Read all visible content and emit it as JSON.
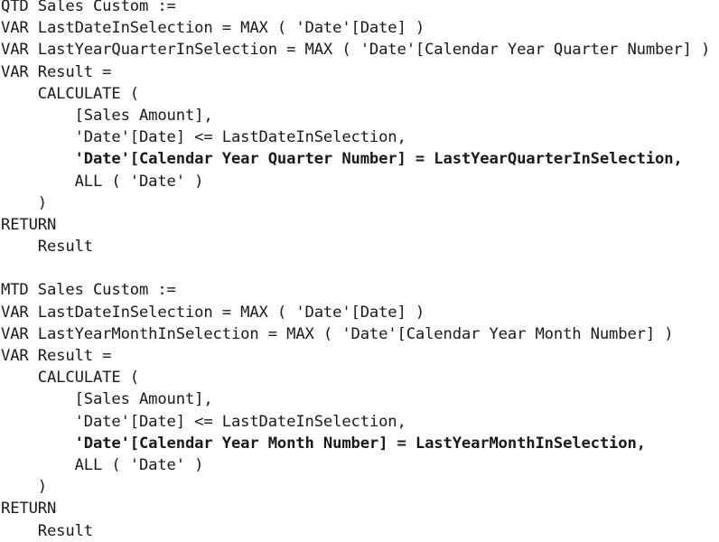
{
  "code": {
    "lines": [
      {
        "text": "QTD Sales Custom :=",
        "bold": false
      },
      {
        "text": "VAR LastDateInSelection = MAX ( 'Date'[Date] )",
        "bold": false
      },
      {
        "text": "VAR LastYearQuarterInSelection = MAX ( 'Date'[Calendar Year Quarter Number] )",
        "bold": false
      },
      {
        "text": "VAR Result =",
        "bold": false
      },
      {
        "text": "    CALCULATE (",
        "bold": false
      },
      {
        "text": "        [Sales Amount],",
        "bold": false
      },
      {
        "text": "        'Date'[Date] <= LastDateInSelection,",
        "bold": false
      },
      {
        "text": "        'Date'[Calendar Year Quarter Number] = LastYearQuarterInSelection,",
        "bold": true
      },
      {
        "text": "        ALL ( 'Date' )",
        "bold": false
      },
      {
        "text": "    )",
        "bold": false
      },
      {
        "text": "RETURN",
        "bold": false
      },
      {
        "text": "    Result",
        "bold": false
      },
      {
        "text": "",
        "bold": false
      },
      {
        "text": "MTD Sales Custom :=",
        "bold": false
      },
      {
        "text": "VAR LastDateInSelection = MAX ( 'Date'[Date] )",
        "bold": false
      },
      {
        "text": "VAR LastYearMonthInSelection = MAX ( 'Date'[Calendar Year Month Number] )",
        "bold": false
      },
      {
        "text": "VAR Result =",
        "bold": false
      },
      {
        "text": "    CALCULATE (",
        "bold": false
      },
      {
        "text": "        [Sales Amount],",
        "bold": false
      },
      {
        "text": "        'Date'[Date] <= LastDateInSelection,",
        "bold": false
      },
      {
        "text": "        'Date'[Calendar Year Month Number] = LastYearMonthInSelection,",
        "bold": true
      },
      {
        "text": "        ALL ( 'Date' )",
        "bold": false
      },
      {
        "text": "    )",
        "bold": false
      },
      {
        "text": "RETURN",
        "bold": false
      },
      {
        "text": "    Result",
        "bold": false
      }
    ]
  }
}
